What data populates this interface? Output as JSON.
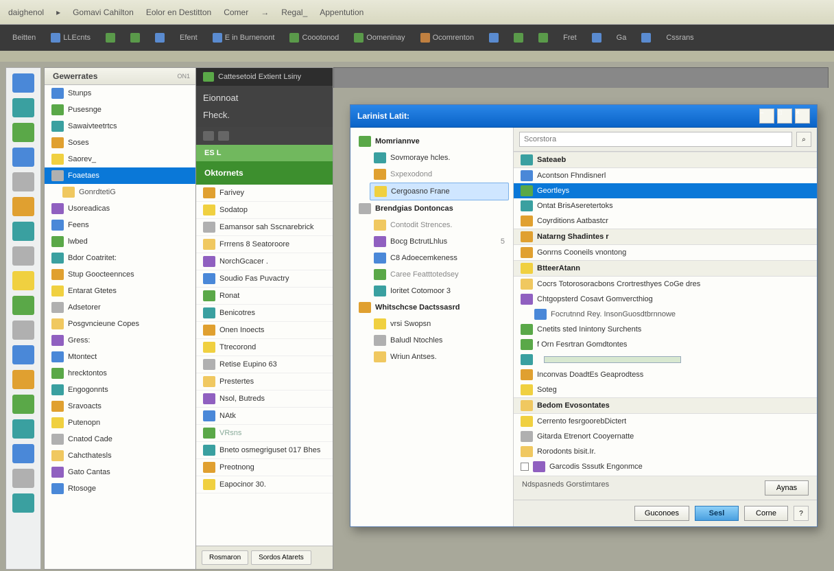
{
  "menubar": [
    "daighenol",
    "Gomavi Cahilton",
    "Eolor en Destitton",
    "Comer",
    "→",
    "Regal_",
    "Appentution"
  ],
  "toolbar": [
    {
      "label": "Beitten"
    },
    {
      "label": "LLEcnts"
    },
    {
      "label": ""
    },
    {
      "label": ""
    },
    {
      "label": ""
    },
    {
      "label": "Efent"
    },
    {
      "label": "E in Burnenont"
    },
    {
      "label": "Coootonod"
    },
    {
      "label": "Oomeninay"
    },
    {
      "label": "Ocomrenton"
    },
    {
      "label": ""
    },
    {
      "label": ""
    },
    {
      "label": ""
    },
    {
      "label": "Fret"
    },
    {
      "label": ""
    },
    {
      "label": "Ga"
    },
    {
      "label": ""
    },
    {
      "label": "Cssrans"
    }
  ],
  "sidebar1": {
    "title": "Gewerrates",
    "tag": "ON1",
    "items": [
      {
        "label": "Stunps"
      },
      {
        "label": "Pusesnge"
      },
      {
        "label": "Sawaivteetrtcs"
      },
      {
        "label": "Soses"
      },
      {
        "label": "Saorev_"
      },
      {
        "label": "Foaetaes",
        "selected": true
      },
      {
        "label": "GonrdtetiG",
        "sub": true
      },
      {
        "label": "Usoreadicas"
      },
      {
        "label": "Feens"
      },
      {
        "label": "lwbed"
      },
      {
        "label": "Bdor Coatritet:"
      },
      {
        "label": "Stup Goocteennces"
      },
      {
        "label": "Entarat Gtetes"
      },
      {
        "label": "Adsetorer"
      },
      {
        "label": "Posgvncieune Copes"
      },
      {
        "label": "Gress:"
      },
      {
        "label": "Mtontect"
      },
      {
        "label": "hrecktontos"
      },
      {
        "label": "Engogonnts"
      },
      {
        "label": "Sravoacts"
      },
      {
        "label": "Putenopn"
      },
      {
        "label": "Cnatod Cade"
      },
      {
        "label": "Cahcthatesls"
      },
      {
        "label": "Gato Cantas"
      },
      {
        "label": "Rtosoge"
      }
    ]
  },
  "sidebar2": {
    "ribbon": "Cattesetoid   Extient Lsiny",
    "title": "Eionnoat",
    "sub": "Fheck.",
    "band_small": "ES L",
    "band": "Oktornets",
    "items": [
      {
        "label": "Farivey"
      },
      {
        "label": "Sodatop"
      },
      {
        "label": "Eamansor sah Sscnarebrick"
      },
      {
        "label": "Frrrens 8 Seatoroore"
      },
      {
        "label": "NorchGcacer ."
      },
      {
        "label": "Soudio Fas Puvactry"
      },
      {
        "label": "Ronat"
      },
      {
        "label": "Benicotres"
      },
      {
        "label": "Onen Inoects"
      },
      {
        "label": "Ttrecorond"
      },
      {
        "label": "Retise Eupino 63"
      },
      {
        "label": "Prestertes"
      },
      {
        "label": "Nsol, Butreds"
      },
      {
        "label": "NAtk"
      },
      {
        "label": "VRsns",
        "muted": true
      },
      {
        "label": "Bneto osmegriguset 017 Bhes"
      },
      {
        "label": "Preotnong"
      },
      {
        "label": "Eapocinor 30."
      }
    ],
    "tabs": [
      "Rosmaron",
      "Sordos Atarets"
    ]
  },
  "dialog": {
    "title": "Larinist Latit:",
    "tree": [
      {
        "label": "Momriannve",
        "header": true
      },
      {
        "label": "Sovmoraye hcles.",
        "indent": true
      },
      {
        "label": "Sxpexodond",
        "indent": true,
        "faint": true
      },
      {
        "label": "Cergoasno Frane",
        "indent": true,
        "selected": true
      },
      {
        "label": "Brendgias Dontoncas",
        "header": true
      },
      {
        "label": "Contodit Strences.",
        "indent": true,
        "faint": true
      },
      {
        "label": "Bocg BctrutLhlus",
        "indent": true,
        "extra": "5"
      },
      {
        "label": "C8 Adoecemkeness",
        "indent": true
      },
      {
        "label": "Caree Featttotedsey",
        "indent": true,
        "faint": true
      },
      {
        "label": "Ioritet Cotomoor 3",
        "indent": true
      },
      {
        "label": "Whitschcse Dactssasrd",
        "header": true
      },
      {
        "label": "vrsi Swopsn",
        "indent": true
      },
      {
        "label": "Baludl Ntochles",
        "indent": true
      },
      {
        "label": "Wriun Antses.",
        "indent": true
      }
    ],
    "search_label": "Scorstora",
    "search_value": "",
    "groups": [
      {
        "title": "Sateaeb",
        "items": [
          {
            "label": "Acontson Fhndisnerl"
          },
          {
            "label": "Geortleys",
            "selected": true
          },
          {
            "label": "Ontat BrisAseretertoks"
          },
          {
            "label": "Coyrditions Aatbastcr"
          }
        ]
      },
      {
        "title": "Natarng Shadintes r",
        "items": [
          {
            "label": "Gonrns Cooneils vnontong"
          }
        ]
      },
      {
        "title": "BtteerAtann",
        "items": [
          {
            "label": "Cocrs Totorosoracbons Crortresthyes CoGe dres"
          },
          {
            "label": "Chtgopsterd Cosavt Gomvercthiog"
          },
          {
            "label": "Focrutnnd Rey. InsonGuosdtbrnnowe",
            "sub": true
          },
          {
            "label": "Cnetits sted Inintony Surchents"
          }
        ]
      },
      {
        "title": "",
        "items": [
          {
            "label": "f Orn Fesrtran Gomdtontes"
          },
          {
            "label": "",
            "progress": true
          },
          {
            "label": "Inconvas DoadtEs Geaprodtess"
          },
          {
            "label": "Soteg"
          }
        ]
      },
      {
        "title": "Bedom Evosontates",
        "items": [
          {
            "label": "Cerrento fesrgoorebDictert"
          },
          {
            "label": "Gitarda Etrenort Cooyernatte"
          },
          {
            "label": "Rorodonts bisit.Ir."
          },
          {
            "label": "Garcodis Sssutk    Engonmce",
            "checkbox": true
          }
        ]
      }
    ],
    "extra_left": "Ndspasneds Gorstimtares",
    "extra_right": "Aynas",
    "buttons": {
      "ok": "Guconoes",
      "primary": "Sesl",
      "cancel": "Corne"
    }
  }
}
